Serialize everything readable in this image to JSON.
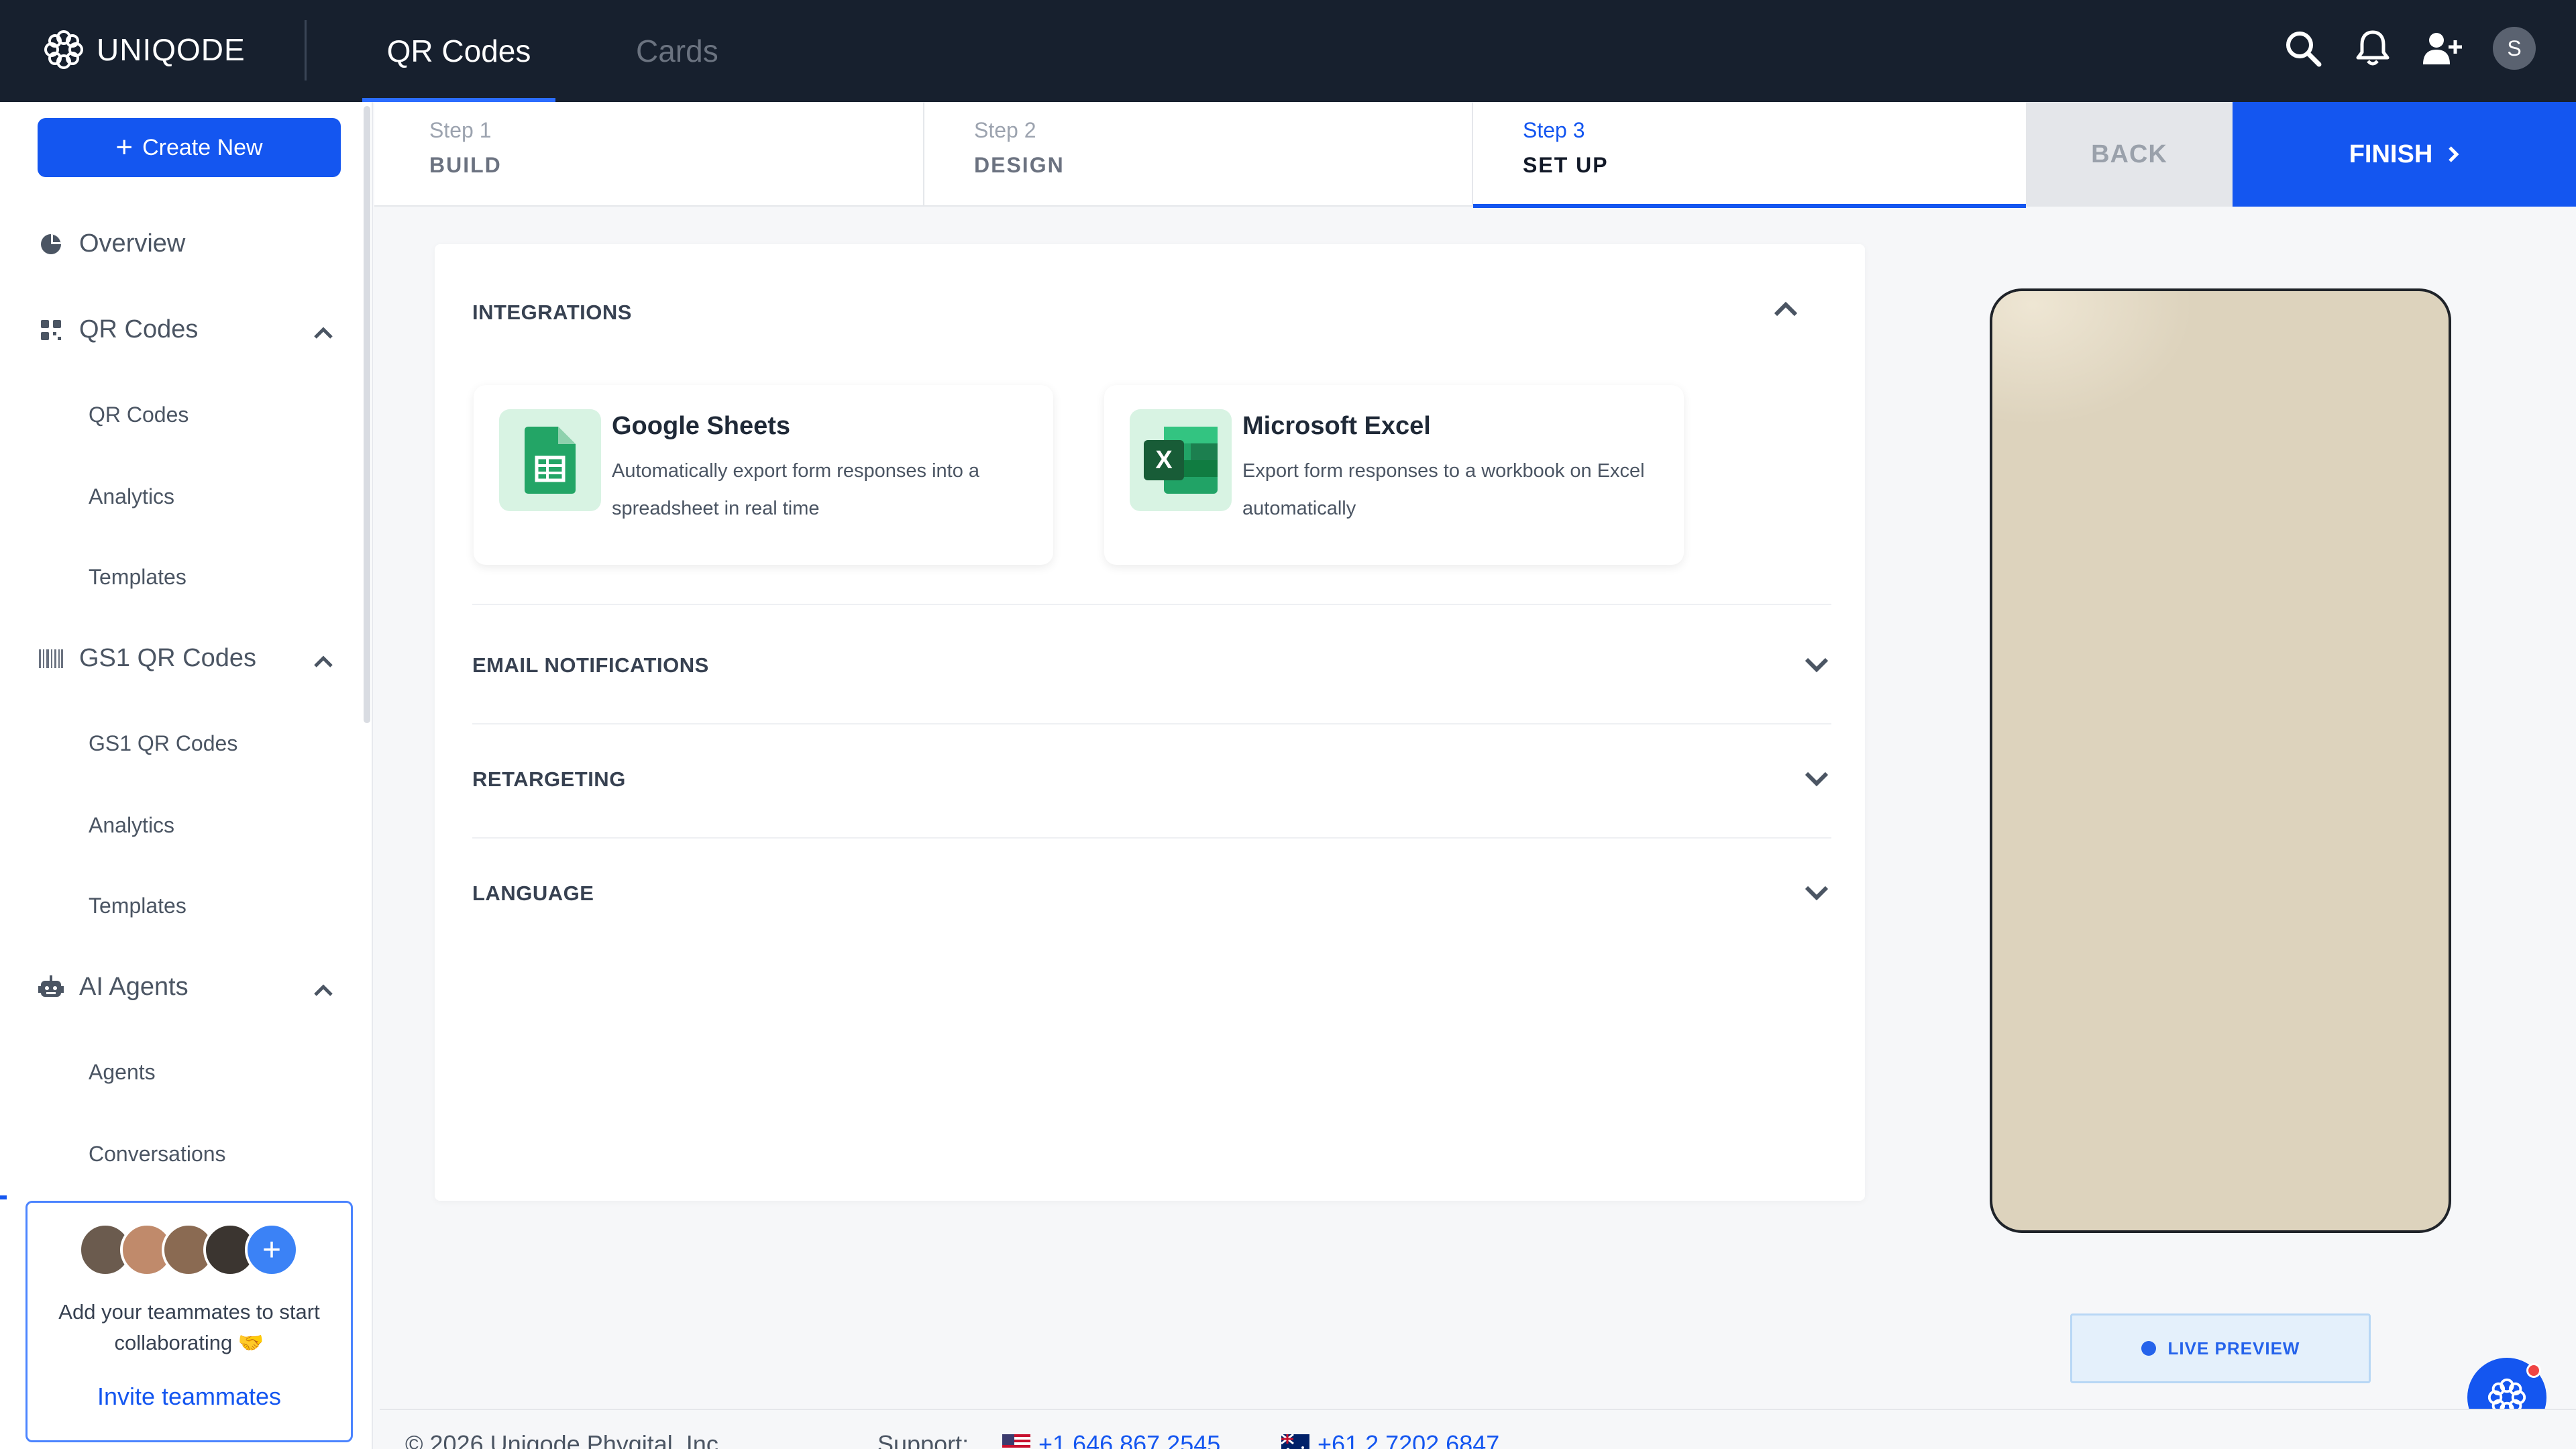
{
  "brand": {
    "name": "UNIQODE"
  },
  "top_tabs": [
    {
      "label": "QR Codes",
      "active": true
    },
    {
      "label": "Cards",
      "active": false
    }
  ],
  "top_icons": [
    "search-icon",
    "bell-icon",
    "add-user-icon"
  ],
  "user": {
    "initial": "S"
  },
  "sidebar": {
    "create_label": "Create New",
    "overview_label": "Overview",
    "groups": [
      {
        "label": "QR Codes",
        "icon": "qr-grid-icon",
        "items": [
          "QR Codes",
          "Analytics",
          "Templates"
        ]
      },
      {
        "label": "GS1 QR Codes",
        "icon": "barcode-icon",
        "items": [
          "GS1 QR Codes",
          "Analytics",
          "Templates"
        ]
      },
      {
        "label": "AI Agents",
        "icon": "robot-icon",
        "items": [
          "Agents",
          "Conversations"
        ]
      }
    ],
    "team": {
      "text": "Add your teammates to start collaborating 🤝",
      "link": "Invite teammates"
    }
  },
  "steps": [
    {
      "num": "Step 1",
      "name": "BUILD",
      "active": false
    },
    {
      "num": "Step 2",
      "name": "DESIGN",
      "active": false
    },
    {
      "num": "Step 3",
      "name": "SET UP",
      "active": true
    }
  ],
  "actions": {
    "back": "BACK",
    "finish": "FINISH"
  },
  "sections": {
    "integrations": "INTEGRATIONS",
    "email": "EMAIL NOTIFICATIONS",
    "retargeting": "RETARGETING",
    "language": "LANGUAGE"
  },
  "integrations": [
    {
      "title": "Google Sheets",
      "desc": "Automatically export form responses into a spreadsheet in real time",
      "icon": "google-sheets-icon",
      "color": "#23a566"
    },
    {
      "title": "Microsoft Excel",
      "desc": "Export form responses to a workbook on Excel automatically",
      "icon": "excel-icon",
      "color": "#1e7145"
    }
  ],
  "preview": {
    "label": "LIVE PREVIEW",
    "bg_color": "#ddd3bd"
  },
  "footer": {
    "copyright": "© 2026 Uniqode Phygital, Inc.",
    "support_label": "Support:",
    "phone_us": "+1 646 867 2545",
    "phone_au": "+61 2 7202 6847"
  },
  "colors": {
    "accent": "#1456f0",
    "topbar": "#17202e"
  }
}
